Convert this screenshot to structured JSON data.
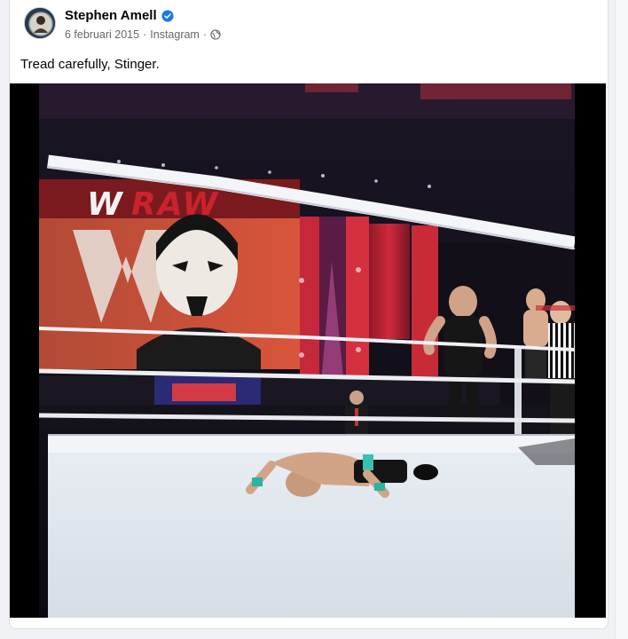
{
  "post": {
    "author": "Stephen Amell",
    "date": "6 februari 2015",
    "separator": "·",
    "source": "Instagram",
    "caption": "Tread carefully, Stinger.",
    "verified": true
  },
  "icons": {
    "verified": "verified-badge-icon",
    "audience": "globe-icon"
  },
  "colors": {
    "verified_blue": "#1877f2",
    "secondary_text": "#65676b",
    "primary_text": "#050505"
  },
  "media": {
    "screen_logo_text": "RAW"
  }
}
